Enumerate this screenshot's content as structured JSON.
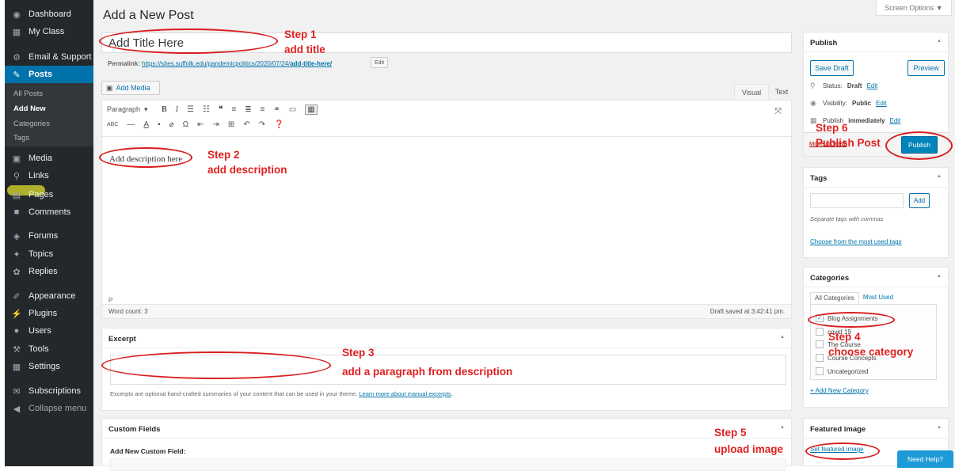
{
  "sidebar": {
    "items": [
      {
        "label": "Dashboard",
        "icon": "dashboard-icon",
        "glyph": "◉"
      },
      {
        "label": "My Class",
        "icon": "class-icon",
        "glyph": "▦"
      },
      {
        "label": "Email & Support",
        "icon": "support-icon",
        "glyph": "⚙"
      },
      {
        "label": "Posts",
        "icon": "pin-icon",
        "glyph": "✎"
      },
      {
        "label": "Media",
        "icon": "media-icon",
        "glyph": "▣"
      },
      {
        "label": "Links",
        "icon": "link-icon",
        "glyph": "⚲"
      },
      {
        "label": "Pages",
        "icon": "pages-icon",
        "glyph": "▤"
      },
      {
        "label": "Comments",
        "icon": "comment-icon",
        "glyph": "■"
      },
      {
        "label": "Forums",
        "icon": "forum-icon",
        "glyph": "◈"
      },
      {
        "label": "Topics",
        "icon": "topics-icon",
        "glyph": "✦"
      },
      {
        "label": "Replies",
        "icon": "replies-icon",
        "glyph": "✿"
      },
      {
        "label": "Appearance",
        "icon": "brush-icon",
        "glyph": "✐"
      },
      {
        "label": "Plugins",
        "icon": "plug-icon",
        "glyph": "⚡"
      },
      {
        "label": "Users",
        "icon": "user-icon",
        "glyph": "●"
      },
      {
        "label": "Tools",
        "icon": "wrench-icon",
        "glyph": "⚒"
      },
      {
        "label": "Settings",
        "icon": "settings-icon",
        "glyph": "▦"
      },
      {
        "label": "Subscriptions",
        "icon": "mail-icon",
        "glyph": "✉"
      },
      {
        "label": "Collapse menu",
        "icon": "collapse-icon",
        "glyph": "◀"
      }
    ],
    "submenu": [
      "All Posts",
      "Add New",
      "Categories",
      "Tags"
    ]
  },
  "header": {
    "title": "Add a New Post",
    "screen_options": "Screen Options ▼"
  },
  "post": {
    "title_value": "Add Title Here",
    "permalink_label": "Permalink:",
    "permalink_url": "https://sites.suffolk.edu/pandemicpolitics/2020/07/24/",
    "permalink_slug": "add-title-here/",
    "edit_label": "Edit"
  },
  "editor": {
    "add_media": "Add Media",
    "tab_visual": "Visual",
    "tab_text": "Text",
    "format_select": "Paragraph",
    "content": "Add description here",
    "path": "P",
    "word_count": "Word count: 3",
    "draft_saved": "Draft saved at 3:42:41 pm."
  },
  "excerpt": {
    "title": "Excerpt",
    "hint": "Excerpts are optional hand-crafted summaries of your content that can be used in your theme.",
    "hint_link": "Learn more about manual excerpts"
  },
  "custom_fields": {
    "title": "Custom Fields",
    "add_new_label": "Add New Custom Field:"
  },
  "publish": {
    "title": "Publish",
    "save_draft": "Save Draft",
    "preview": "Preview",
    "status_label": "Status:",
    "status_value": "Draft",
    "visibility_label": "Visibility:",
    "visibility_value": "Public",
    "publish_label": "Publish",
    "publish_value": "immediately",
    "edit": "Edit",
    "move_trash": "Move to Trash",
    "publish_btn": "Publish"
  },
  "tags": {
    "title": "Tags",
    "add": "Add",
    "hint": "Separate tags with commas",
    "choose": "Choose from the most used tags"
  },
  "categories": {
    "title": "Categories",
    "tab_all": "All Categories",
    "tab_used": "Most Used",
    "items": [
      {
        "label": "Blog Assignments",
        "checked": "✓"
      },
      {
        "label": "covid 19",
        "checked": ""
      },
      {
        "label": "The Course",
        "checked": ""
      },
      {
        "label": "Course Concepts",
        "checked": ""
      },
      {
        "label": "Uncategorized",
        "checked": ""
      }
    ],
    "add_new": "+ Add New Category"
  },
  "featured": {
    "title": "Featured image",
    "link": "Set featured image"
  },
  "help": "Need Help?",
  "annotations": {
    "step1": "Step 1",
    "step1_desc": "add title",
    "step2": "Step 2",
    "step2_desc": "add description",
    "step3": "Step 3",
    "step3_desc": "add a paragraph from description",
    "step4": "Step 4",
    "step4_desc": "choose category",
    "step5": "Step 5",
    "step5_desc": "upload image",
    "step6": "Step 6",
    "step6_desc": "Publish Post",
    "color": "#e02020"
  }
}
